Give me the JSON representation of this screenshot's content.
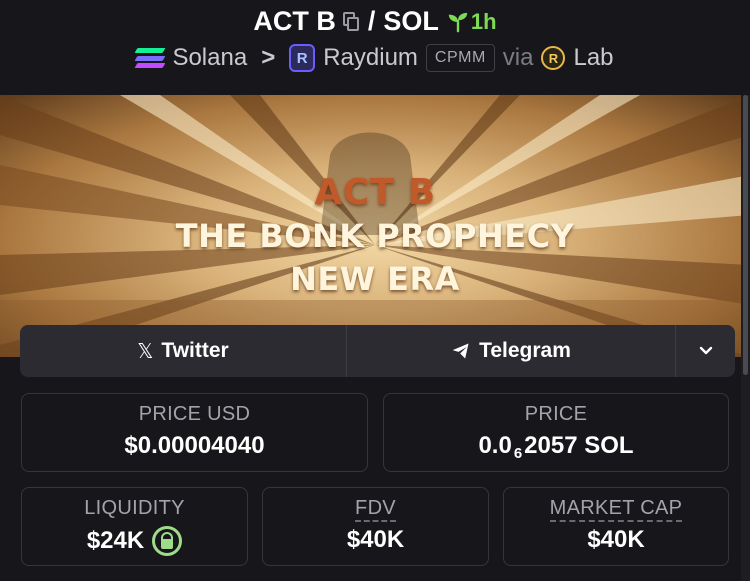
{
  "header": {
    "token_symbol": "ACT B",
    "separator": "/",
    "quote_symbol": "SOL",
    "age": "1h",
    "breadcrumb": {
      "chain": "Solana",
      "dex": "Raydium",
      "pool_type": "CPMM",
      "via_label": "via",
      "launchpad": "Lab"
    },
    "icons": [
      "copy-icon",
      "sprout-icon",
      "solana-logo",
      "chevron-right-icon",
      "raydium-logo",
      "lab-logo"
    ]
  },
  "banner": {
    "line1": "ACT B",
    "line2": "THE BONK PROPHECY",
    "line3": "NEW ERA"
  },
  "social": {
    "twitter_label": "Twitter",
    "telegram_label": "Telegram",
    "icons": [
      "x-icon",
      "telegram-icon",
      "chevron-down-icon"
    ]
  },
  "stats": {
    "price_usd_label": "PRICE USD",
    "price_usd_value": "$0.00004040",
    "price_label": "PRICE",
    "price_prefix": "0.0",
    "price_zero_count": "6",
    "price_suffix": "2057 SOL",
    "liquidity_label": "LIQUIDITY",
    "liquidity_value": "$24K",
    "fdv_label": "FDV",
    "fdv_value": "$40K",
    "mcap_label": "MARKET CAP",
    "mcap_value": "$40K"
  },
  "colors": {
    "background": "#17171b",
    "card_border": "#35353c",
    "age_green": "#7ed957",
    "lock_green": "#9fdc8a",
    "banner_red_text": "#c05a2a"
  }
}
